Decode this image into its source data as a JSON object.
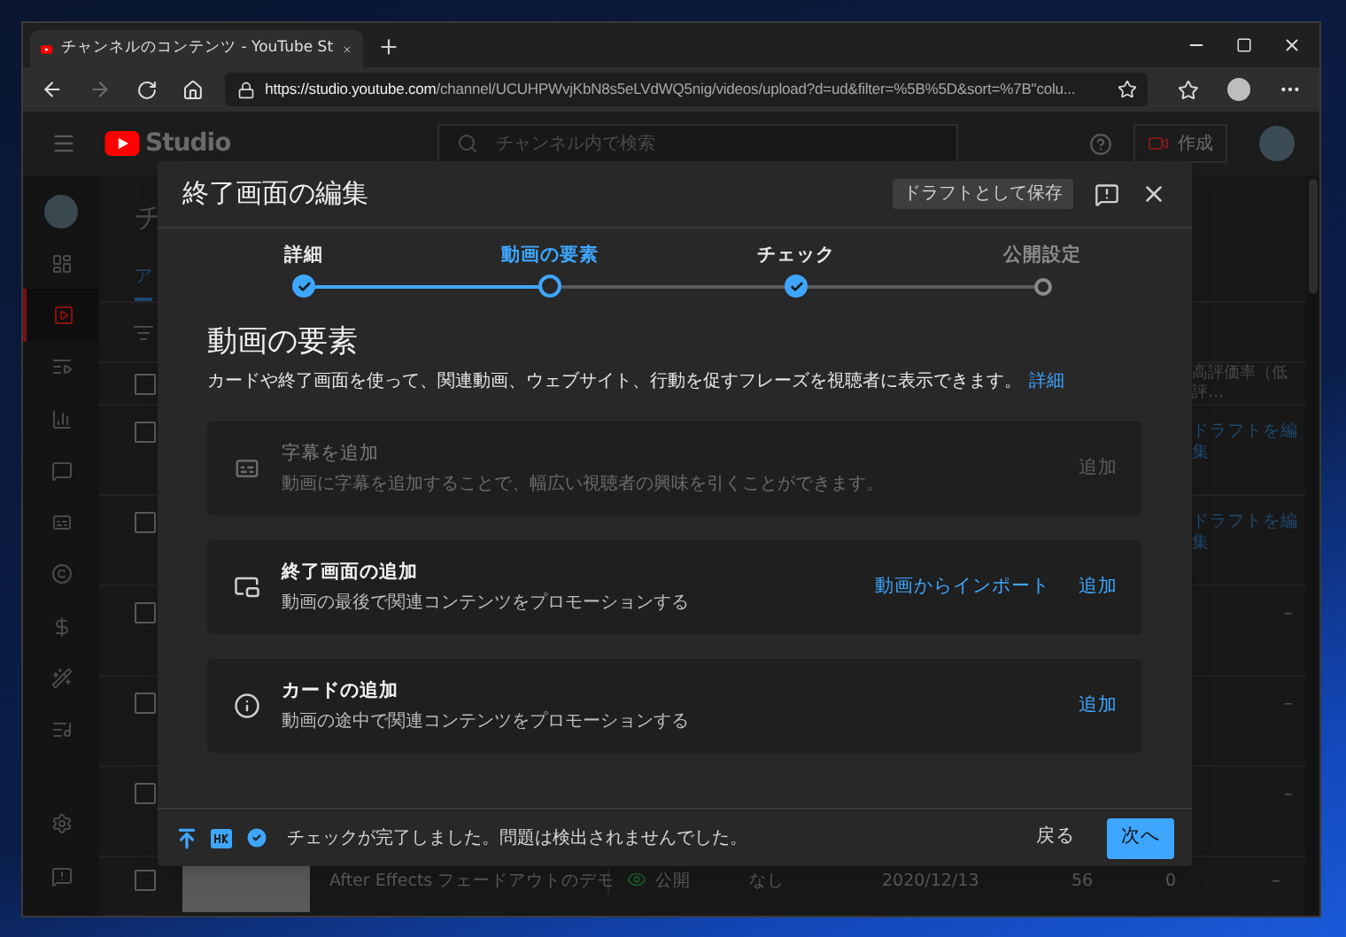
{
  "browser": {
    "tab_title": "チャンネルのコンテンツ - YouTube St",
    "url_host": "https://studio.youtube.com",
    "url_path": "/channel/UCUHPWvjKbN8s5eLVdWQ5nig/videos/upload?d=ud&filter=%5B%5D&sort=%7B\"colu..."
  },
  "studio": {
    "logo": "Studio",
    "search_placeholder": "チャンネル内で検索",
    "create": "作成"
  },
  "sidebar": {
    "items": [
      {
        "selected": false
      },
      {
        "selected": true
      },
      {
        "selected": false
      },
      {
        "selected": false
      },
      {
        "selected": false
      },
      {
        "selected": false
      },
      {
        "selected": false
      },
      {
        "selected": false
      },
      {
        "selected": false
      },
      {
        "selected": false
      }
    ],
    "bottom_items": [
      {
        "selected": false
      },
      {
        "selected": false
      }
    ]
  },
  "page": {
    "title": "チ",
    "tab": "ア"
  },
  "table": {
    "header_checked": false,
    "header_last": "高評価率（低評…",
    "rows": [
      {
        "kind": "draft",
        "checked": false,
        "action": "ドラフトを編集"
      },
      {
        "kind": "draft",
        "checked": false,
        "action": "ドラフトを編集"
      },
      {
        "kind": "rating",
        "checked": false,
        "rating": "–"
      },
      {
        "kind": "rating",
        "checked": false,
        "rating": "–"
      },
      {
        "kind": "rating",
        "checked": false,
        "rating": "–"
      },
      {
        "kind": "video",
        "checked": false,
        "title": "After Effects フェードアウトのデモ",
        "visibility": "公開",
        "restrictions": "なし",
        "date": "2020/12/13",
        "views": "56",
        "comments": "0",
        "rating": "–"
      }
    ]
  },
  "modal": {
    "title": "終了画面の編集",
    "save_draft": "ドラフトとして保存",
    "steps": [
      {
        "label": "詳細",
        "completed": true,
        "selected": false
      },
      {
        "label": "動画の要素",
        "completed": false,
        "selected": true
      },
      {
        "label": "チェック",
        "completed": true,
        "selected": false
      },
      {
        "label": "公開設定",
        "completed": false,
        "selected": false
      }
    ],
    "heading": "動画の要素",
    "description": "カードや終了画面を使って、関連動画、ウェブサイト、行動を促すフレーズを視聴者に表示できます。",
    "learn_more": "詳細",
    "cards": [
      {
        "title": "字幕を追加",
        "description": "動画に字幕を追加することで、幅広い視聴者の興味を引くことができます。",
        "disabled": true,
        "actions": [
          "追加"
        ]
      },
      {
        "title": "終了画面の追加",
        "description": "動画の最後で関連コンテンツをプロモーションする",
        "disabled": false,
        "actions": [
          "動画からインポート",
          "追加"
        ]
      },
      {
        "title": "カードの追加",
        "description": "動画の途中で関連コンテンツをプロモーションする",
        "disabled": false,
        "actions": [
          "追加"
        ]
      }
    ],
    "footer": {
      "message": "チェックが完了しました。問題は検出されませんでした。",
      "back": "戻る",
      "next": "次へ"
    }
  }
}
